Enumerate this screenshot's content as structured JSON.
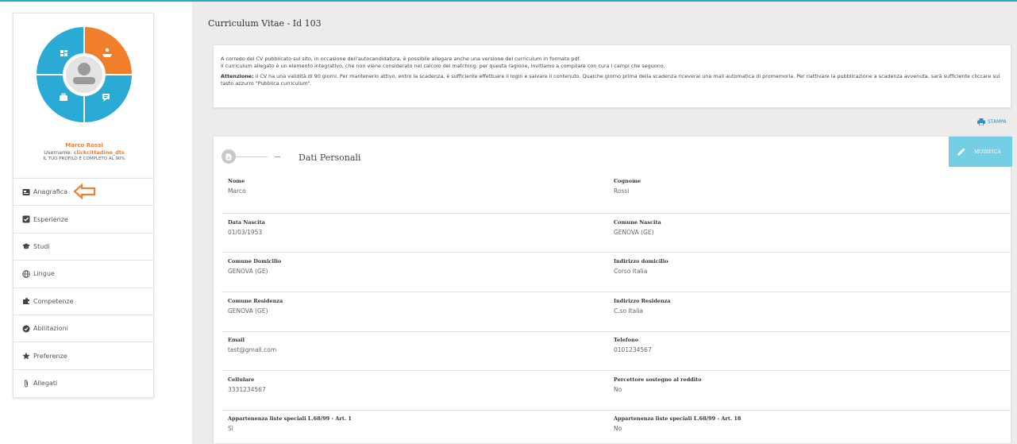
{
  "colors": {
    "accent_blue": "#2aa7c9",
    "accent_orange": "#f07e2a",
    "edit_button": "#74cfe4",
    "background": "#eeeceb"
  },
  "profile": {
    "name": "Marco Rossi",
    "username_label": "Username:",
    "username": "clickcittadino_dts",
    "completion": "IL TUO PROFILO È COMPLETO AL 90%",
    "completion_percent": 90,
    "donut_icons": [
      "dashboard-icon",
      "hand-cash-icon",
      "briefcase-icon",
      "chat-icon",
      "user-avatar-icon"
    ]
  },
  "menu": [
    {
      "label": "Anagrafica",
      "icon": "id-card-icon"
    },
    {
      "label": "Esperienze",
      "icon": "check-square-icon"
    },
    {
      "label": "Studi",
      "icon": "graduation-cap-icon"
    },
    {
      "label": "Lingue",
      "icon": "globe-icon"
    },
    {
      "label": "Competenze",
      "icon": "puzzle-icon"
    },
    {
      "label": "Abilitazioni",
      "icon": "badge-icon"
    },
    {
      "label": "Preferenze",
      "icon": "star-icon"
    },
    {
      "label": "Allegati",
      "icon": "paperclip-icon"
    }
  ],
  "page": {
    "title": "Curriculum Vitae - Id 103",
    "info_line1": "A corredo del CV pubblicato sul sito, in occasione dell'autocandidatura, è possibile allegare anche una versione del curriculum in formato pdf.",
    "info_line2": "Il curriculum allegato è un elemento integrativo, che non viene considerato nel calcolo del matching: per questa ragione, invitiamo a compilare con cura i campi che seguono.",
    "attention_label": "Attenzione:",
    "attention_text": "il CV ha una validità di 90 giorni. Per mantenerlo attivo, entro la scadenza, è sufficiente effettuare il login e salvare il contenuto. Qualche giorno prima della scadenza riceverai una mail automatica di promemoria. Per riattivare la pubblicazione a scadenza avvenuta, sarà sufficiente cliccare sul tasto azzurro \"Pubblica curriculum\".",
    "print_label": "STAMPA"
  },
  "section": {
    "title": "Dati Personali",
    "edit_label": "MODIFICA"
  },
  "fields": [
    {
      "left_label": "Nome",
      "left_value": "Marco",
      "right_label": "Cognome",
      "right_value": "Rossi"
    },
    {
      "left_label": "Data Nascita",
      "left_value": "01/03/1953",
      "right_label": "Comune Nascita",
      "right_value": "GENOVA (GE)"
    },
    {
      "left_label": "Comune Domicilio",
      "left_value": "GENOVA (GE)",
      "right_label": "Indirizzo domicilio",
      "right_value": "Corso Italia"
    },
    {
      "left_label": "Comune Residenza",
      "left_value": "GENOVA (GE)",
      "right_label": "Indirizzo Residenza",
      "right_value": "C.so Italia"
    },
    {
      "left_label": "Email",
      "left_value": "test@gmail.com",
      "right_label": "Telefono",
      "right_value": "0101234567"
    },
    {
      "left_label": "Cellulare",
      "left_value": "3331234567",
      "right_label": "Percettore sostegno al reddito",
      "right_value": "No"
    },
    {
      "left_label": "Appartenenza liste speciali L.68/99 - Art. 1",
      "left_value": "Sì",
      "right_label": "Appartenenza liste speciali L.68/99 - Art. 18",
      "right_value": "No"
    }
  ]
}
